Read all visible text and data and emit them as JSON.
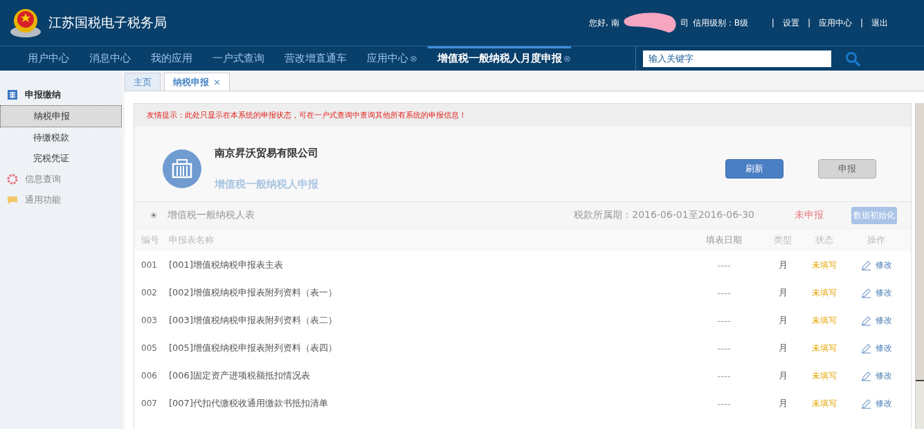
{
  "header": {
    "title": "江苏国税电子税务局",
    "greeting_start": "您好, 南",
    "greeting_end": "司",
    "credit": "信用级别：B级",
    "links": [
      {
        "separator": "|",
        "label": "设置"
      },
      {
        "separator": "|",
        "label": "应用中心"
      },
      {
        "separator": "|",
        "label": "退出"
      }
    ]
  },
  "nav": {
    "items": [
      {
        "label": "用户中心",
        "selected": false
      },
      {
        "label": "消息中心",
        "selected": false
      },
      {
        "label": "我的应用",
        "selected": false
      },
      {
        "label": "一户式查询",
        "selected": false
      },
      {
        "label": "营改增直通车",
        "selected": false
      },
      {
        "label": "应用中心",
        "selected": false,
        "close": "⊗"
      },
      {
        "label": "增值税一般纳税人月度申报",
        "selected": true,
        "close": "⊗"
      }
    ],
    "search": {
      "placeholder": "输入关键字"
    }
  },
  "sidebar": {
    "groups": [
      {
        "label": "申报缴纳",
        "children": [
          {
            "label": "纳税申报",
            "selected": true
          },
          {
            "label": "待缴税款",
            "selected": false
          },
          {
            "label": "完税凭证",
            "selected": false
          }
        ]
      },
      {
        "label": "信息查询"
      },
      {
        "label": "通用功能"
      }
    ]
  },
  "tabs": [
    {
      "label": "主页",
      "selected": false
    },
    {
      "label": "纳税申报",
      "selected": true,
      "close": "×"
    }
  ],
  "notice": "友情提示：此处只显示在本系统的申报状态，可在一户式查询中查询其他所有系统的申报信息！",
  "company": {
    "name": "南京昇沃贸易有限公司",
    "subtitle": "增值税一般纳税人申报",
    "buttons": [
      {
        "label": "刷新",
        "kind": "primary"
      },
      {
        "label": "申报",
        "kind": "secondary"
      }
    ]
  },
  "form_row": {
    "selected": true,
    "label": "增值税一般纳税人表",
    "period": "税款所属期：2016-06-01至2016-06-30",
    "status": "未申报",
    "action": "数据初始化"
  },
  "table": {
    "columns": [
      "编号",
      "申报表名称",
      "填表日期",
      "类型",
      "状态",
      "操作"
    ],
    "rows": [
      [
        "001",
        "[001]增值税纳税申报表主表",
        "----",
        "月",
        "未填写",
        "修改"
      ],
      [
        "002",
        "[002]增值税纳税申报表附列资料（表一）",
        "----",
        "月",
        "未填写",
        "修改"
      ],
      [
        "003",
        "[003]增值税纳税申报表附列资料（表二）",
        "----",
        "月",
        "未填写",
        "修改"
      ],
      [
        "005",
        "[005]增值税纳税申报表附列资料（表四）",
        "----",
        "月",
        "未填写",
        "修改"
      ],
      [
        "006",
        "[006]固定资产进项税额抵扣情况表",
        "----",
        "月",
        "未填写",
        "修改"
      ],
      [
        "007",
        "[007]代扣代缴税收通用缴款书抵扣清单",
        "----",
        "月",
        "未填写",
        "修改"
      ]
    ]
  }
}
